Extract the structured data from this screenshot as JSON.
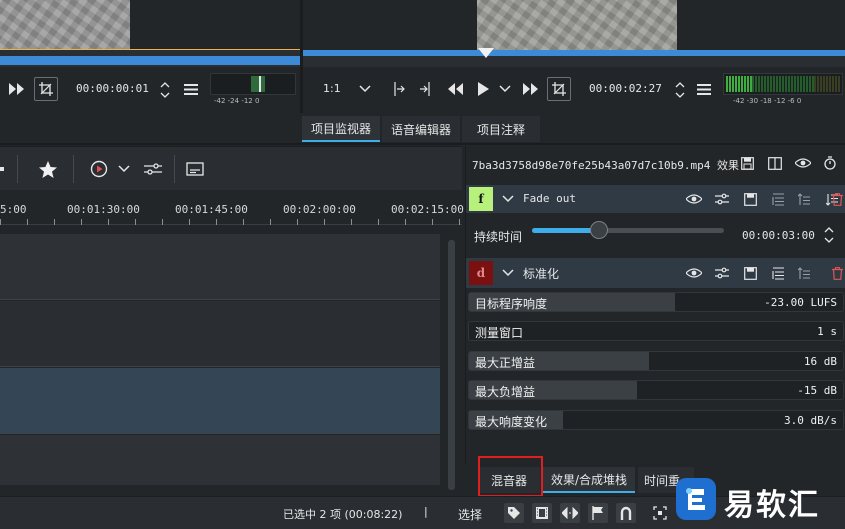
{
  "left_monitor": {
    "timecode": "00:00:00:01",
    "meter_scale": "-42  -24  -12   0"
  },
  "right_monitor": {
    "zoom": "1:1",
    "timecode": "00:00:02:27",
    "meter_scale": "-42 -30   -18 -12  -6  0"
  },
  "monitor_tabs": [
    "项目监视器",
    "语音编辑器",
    "项目注释"
  ],
  "timeline": {
    "ruler": [
      "5:00",
      "00:01:30:00",
      "00:01:45:00",
      "00:02:00:00",
      "00:02:15:00"
    ]
  },
  "effects": {
    "title": "7ba3d3758d98e70fe25b43a07d7c10b9.mp4 效果",
    "fade_out": {
      "badge": "f",
      "name": "Fade out",
      "duration_label": "持续时间",
      "duration_value": "00:00:03:00",
      "slider_fraction": 0.35
    },
    "normalize": {
      "badge": "d",
      "name": "标准化",
      "params": [
        {
          "label": "目标程序响度",
          "value": "-23.00 LUFS",
          "fill": 0.55
        },
        {
          "label": "测量窗口",
          "value": "1 s",
          "fill": 0.0
        },
        {
          "label": "最大正增益",
          "value": "16 dB",
          "fill": 0.48
        },
        {
          "label": "最大负增益",
          "value": "-15 dB",
          "fill": 0.45
        },
        {
          "label": "最大响度变化",
          "value": "3.0 dB/s",
          "fill": 0.25
        }
      ]
    }
  },
  "bottom_tabs": [
    "混音器",
    "效果/合成堆栈",
    "时间重"
  ],
  "status": {
    "selection": "已选中 2 项 (00:08:22)",
    "separator": "|",
    "mode": "选择"
  },
  "watermark": {
    "text": "易软汇"
  },
  "colors": {
    "accent": "#3daee9",
    "fade_badge": "#b7f07a",
    "normalize_badge": "#7a1010",
    "highlight_box": "#e02020",
    "scrub_blue": "#3d8ad6",
    "left_playhead": "#e8b34a"
  }
}
